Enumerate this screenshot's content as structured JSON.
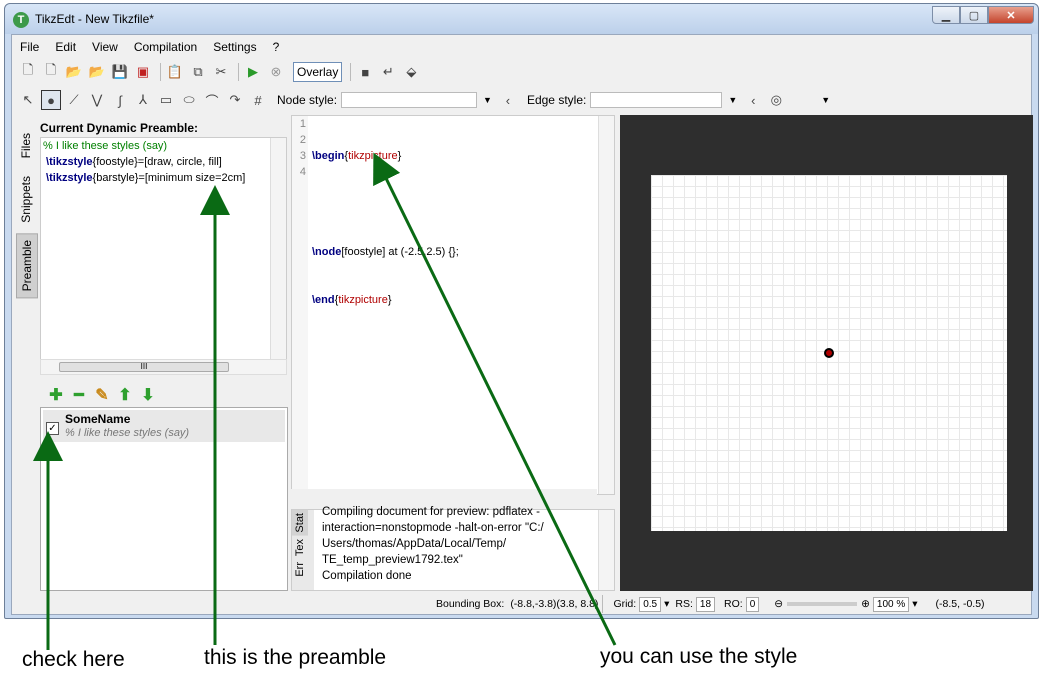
{
  "window": {
    "title": "TikzEdt - New Tikzfile*",
    "app_icon": "T"
  },
  "menu": [
    "File",
    "Edit",
    "View",
    "Compilation",
    "Settings",
    "?"
  ],
  "toolbar": {
    "overlay_label": "Overlay"
  },
  "toolbar2": {
    "node_style_label": "Node style:",
    "edge_style_label": "Edge style:"
  },
  "sidetabs": [
    "Files",
    "Snippets",
    "Preamble"
  ],
  "preamble": {
    "title": "Current Dynamic Preamble:",
    "lines": [
      {
        "kw": "",
        "rest": "% I like these styles (say)"
      },
      {
        "kw": " \\tikzstyle",
        "rest": "{foostyle}=[draw, circle, fill]"
      },
      {
        "kw": " \\tikzstyle",
        "rest": "{barstyle}=[minimum size=2cm]"
      }
    ],
    "scroll_thumb": "III"
  },
  "stylelist": [
    {
      "name": "SomeName",
      "desc": "% I like these styles (say)",
      "checked": "✓"
    }
  ],
  "editor": {
    "line_numbers": [
      "1",
      "2",
      "3",
      "4"
    ],
    "lines": [
      "\\begin{tikzpicture}",
      "",
      "\\node[foostyle] at (-2.5,2.5) {};",
      "\\end{tikzpicture}"
    ]
  },
  "log": {
    "tabs": [
      "Stat",
      "Tex",
      "Err"
    ],
    "lines": [
      "Compiling document for preview: pdflatex -",
      "interaction=nonstopmode -halt-on-error \"C:/",
      "Users/thomas/AppData/Local/Temp/",
      "TE_temp_preview1792.tex\"",
      "Compilation done"
    ]
  },
  "statusbar": {
    "bbox_label": "Bounding Box:",
    "bbox_value": "(-8.8,-3.8)(3.8, 8.8)",
    "grid_label": "Grid:",
    "grid_value": "0.5",
    "rs_label": "RS:",
    "rs_value": "18",
    "ro_label": "RO:",
    "ro_value": "0",
    "zoom_value": "100 %",
    "coords": "(-8.5, -0.5)"
  },
  "annotations": {
    "check": "check here",
    "preamble": "this is the preamble",
    "style": "you can use the style"
  }
}
